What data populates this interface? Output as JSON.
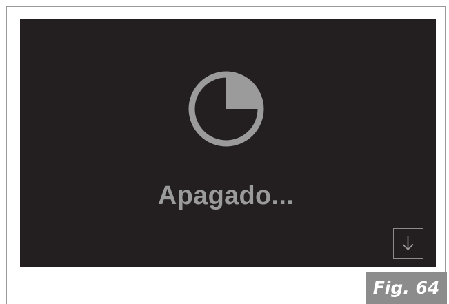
{
  "screen": {
    "status_text": "Apagado...",
    "timer_icon": "pie-timer-icon",
    "down_button_icon": "arrow-down-icon"
  },
  "figure": {
    "label": "Fig. 64"
  },
  "colors": {
    "screen_background": "#231f20",
    "icon_gray": "#9b9b9b",
    "frame_gray": "#9a9a9a",
    "label_background": "#8c8c8c"
  }
}
